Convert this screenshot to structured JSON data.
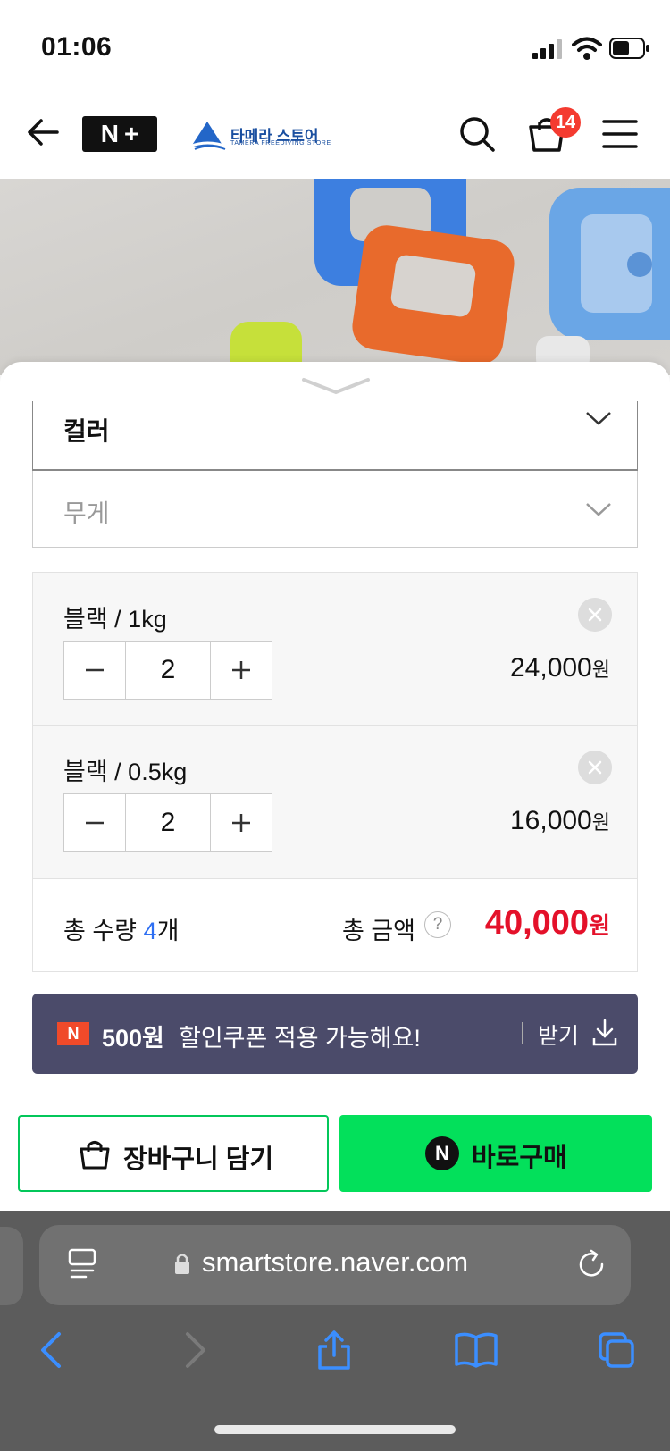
{
  "status": {
    "time": "01:06"
  },
  "header": {
    "nplus_label_n": "N",
    "nplus_label_plus": "+",
    "store_name": "타메라 스토어",
    "store_sub": "TAMERA FREEDIVING STORE",
    "cart_count": "14"
  },
  "options": {
    "color_label": "컬러",
    "weight_placeholder": "무게"
  },
  "items": [
    {
      "name": "블랙 / 1kg",
      "qty": "2",
      "price": "24,000",
      "unit": "원"
    },
    {
      "name": "블랙 / 0.5kg",
      "qty": "2",
      "price": "16,000",
      "unit": "원"
    }
  ],
  "stepper": {
    "minus": "−",
    "plus": "+"
  },
  "total": {
    "qty_prefix": "총 수량 ",
    "qty_value": "4",
    "qty_suffix": "개",
    "amount_label": "총 금액",
    "help": "?",
    "amount_value": "40,000",
    "amount_unit": "원"
  },
  "coupon": {
    "badge": "N",
    "amount": "500원",
    "text": "할인쿠폰 적용 가능해요!",
    "get_label": "받기"
  },
  "actions": {
    "cart_label": "장바구니 담기",
    "buy_badge": "N",
    "buy_label": "바로구매"
  },
  "browser": {
    "url": "smartstore.naver.com"
  },
  "colors": {
    "accent_green": "#03c75a",
    "price_red": "#e4112a",
    "qty_blue": "#2e6ff2",
    "coupon_bg": "#4b4b6a"
  }
}
